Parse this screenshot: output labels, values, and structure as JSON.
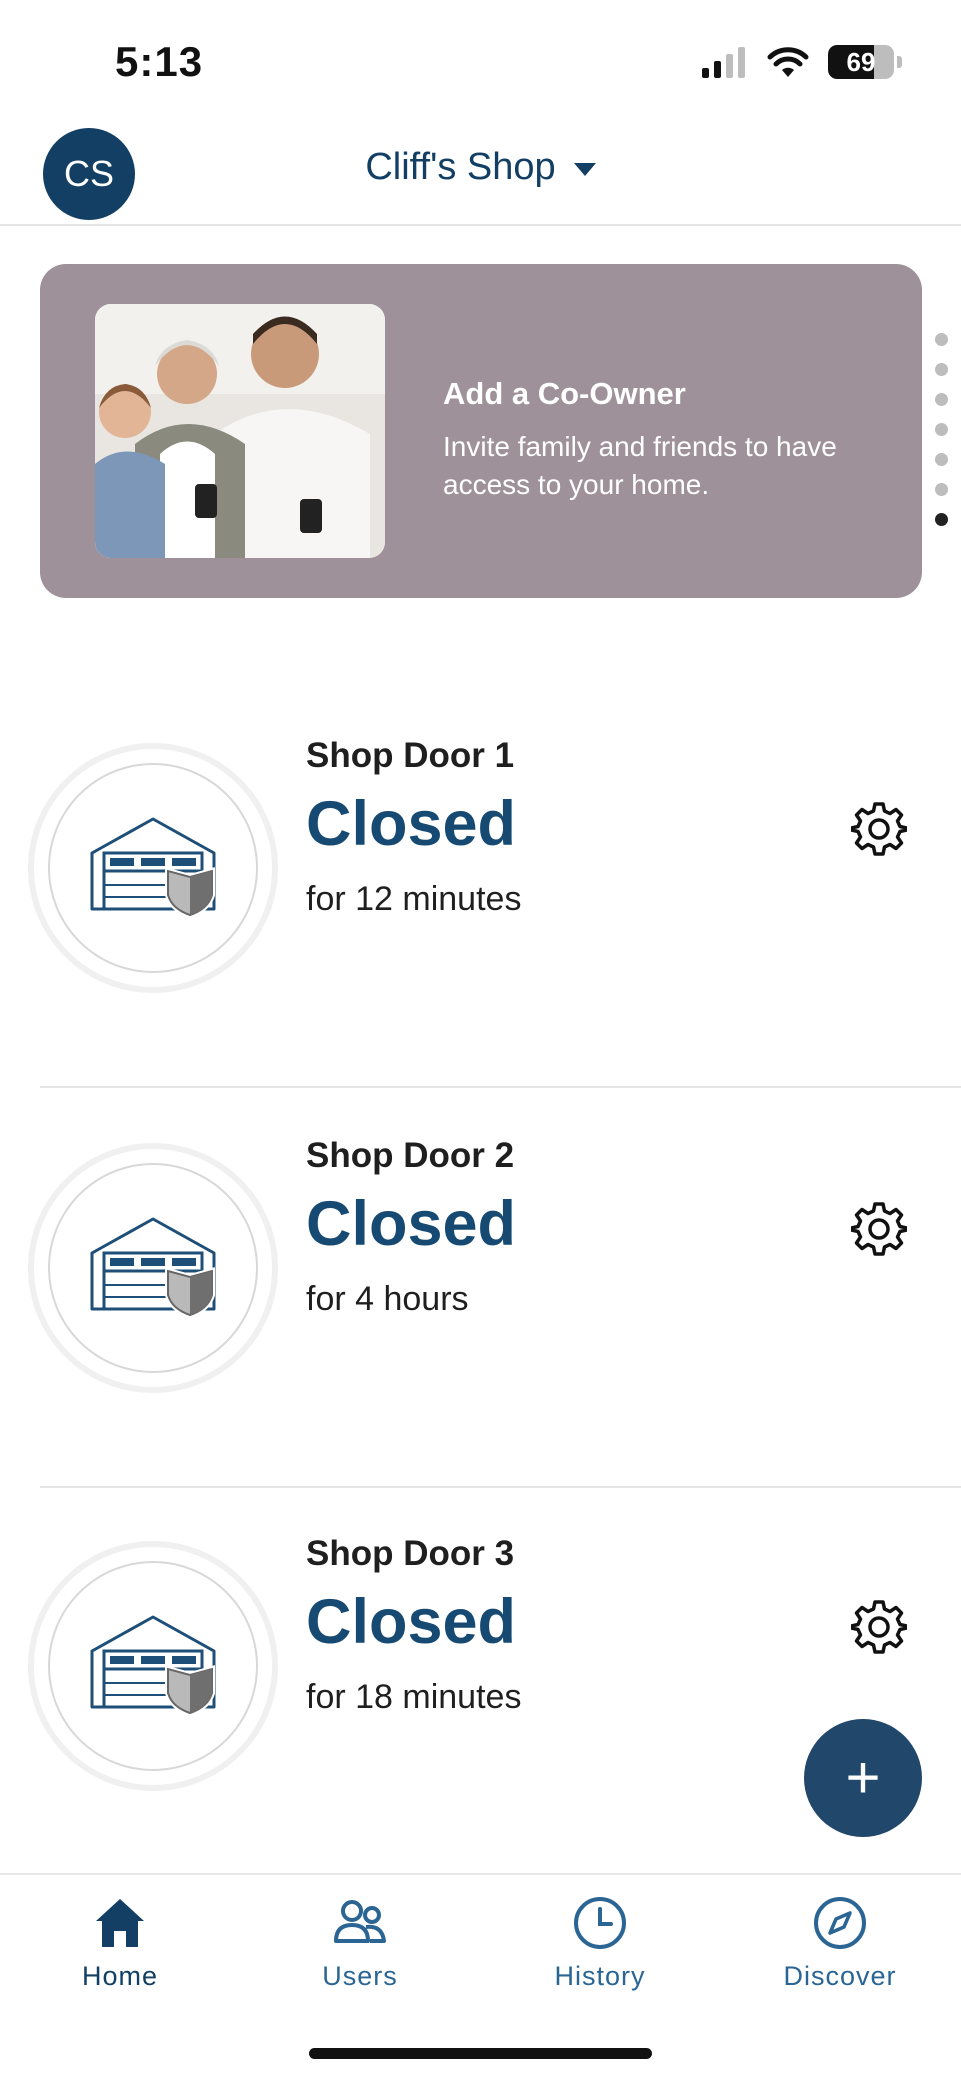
{
  "status_bar": {
    "time": "5:13",
    "battery_level": 69,
    "battery_text": "69"
  },
  "header": {
    "avatar_initials": "CS",
    "location_name": "Cliff's Shop"
  },
  "banner": {
    "title": "Add a Co-Owner",
    "text": "Invite family and friends to have access to your home.",
    "dot_count": 7,
    "active_dot": 6
  },
  "doors": [
    {
      "name": "Shop Door 1",
      "status": "Closed",
      "duration": "for 12 minutes"
    },
    {
      "name": "Shop Door 2",
      "status": "Closed",
      "duration": "for 4 hours"
    },
    {
      "name": "Shop Door 3",
      "status": "Closed",
      "duration": "for 18 minutes"
    }
  ],
  "fab": {
    "label": "+"
  },
  "nav": {
    "tabs": [
      {
        "label": "Home",
        "icon": "home-icon",
        "active": true
      },
      {
        "label": "Users",
        "icon": "users-icon",
        "active": false
      },
      {
        "label": "History",
        "icon": "clock-icon",
        "active": false
      },
      {
        "label": "Discover",
        "icon": "compass-icon",
        "active": false
      }
    ]
  },
  "colors": {
    "brand": "#123f63",
    "status_text": "#174a72",
    "banner_bg": "#9e9199",
    "tab_label": "#2a6594"
  }
}
